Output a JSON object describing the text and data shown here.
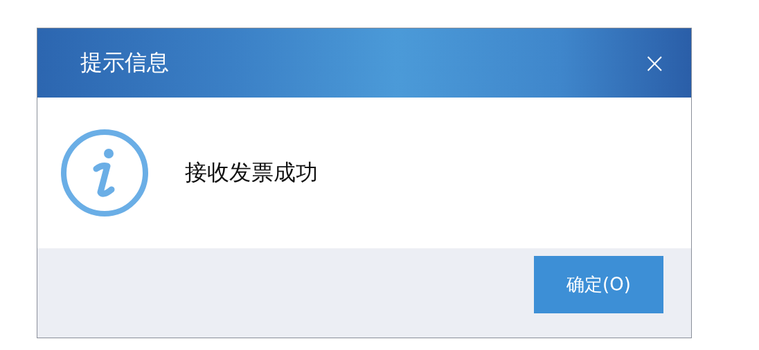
{
  "dialog": {
    "title": "提示信息",
    "close": "×",
    "message": "接收发票成功",
    "buttons": [
      "确定(O)"
    ]
  }
}
